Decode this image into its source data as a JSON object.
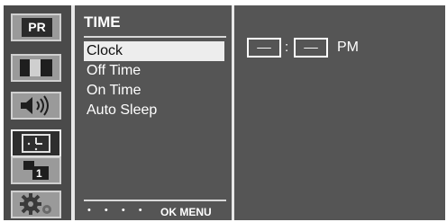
{
  "icons": [
    {
      "name": "PR",
      "label": "PR"
    },
    {
      "name": "picture",
      "label": ""
    },
    {
      "name": "sound",
      "label": ""
    },
    {
      "name": "time",
      "label": ""
    },
    {
      "name": "input",
      "label": "1"
    },
    {
      "name": "setup",
      "label": ""
    }
  ],
  "menu": {
    "title": "TIME",
    "items": [
      "Clock",
      "Off Time",
      "On Time",
      "Auto Sleep"
    ],
    "selected": "Clock",
    "footer_dots": "• • • •",
    "footer_label": "OK MENU"
  },
  "clock": {
    "hour": "––",
    "minute": "––",
    "separator": ":",
    "ampm": "PM"
  }
}
